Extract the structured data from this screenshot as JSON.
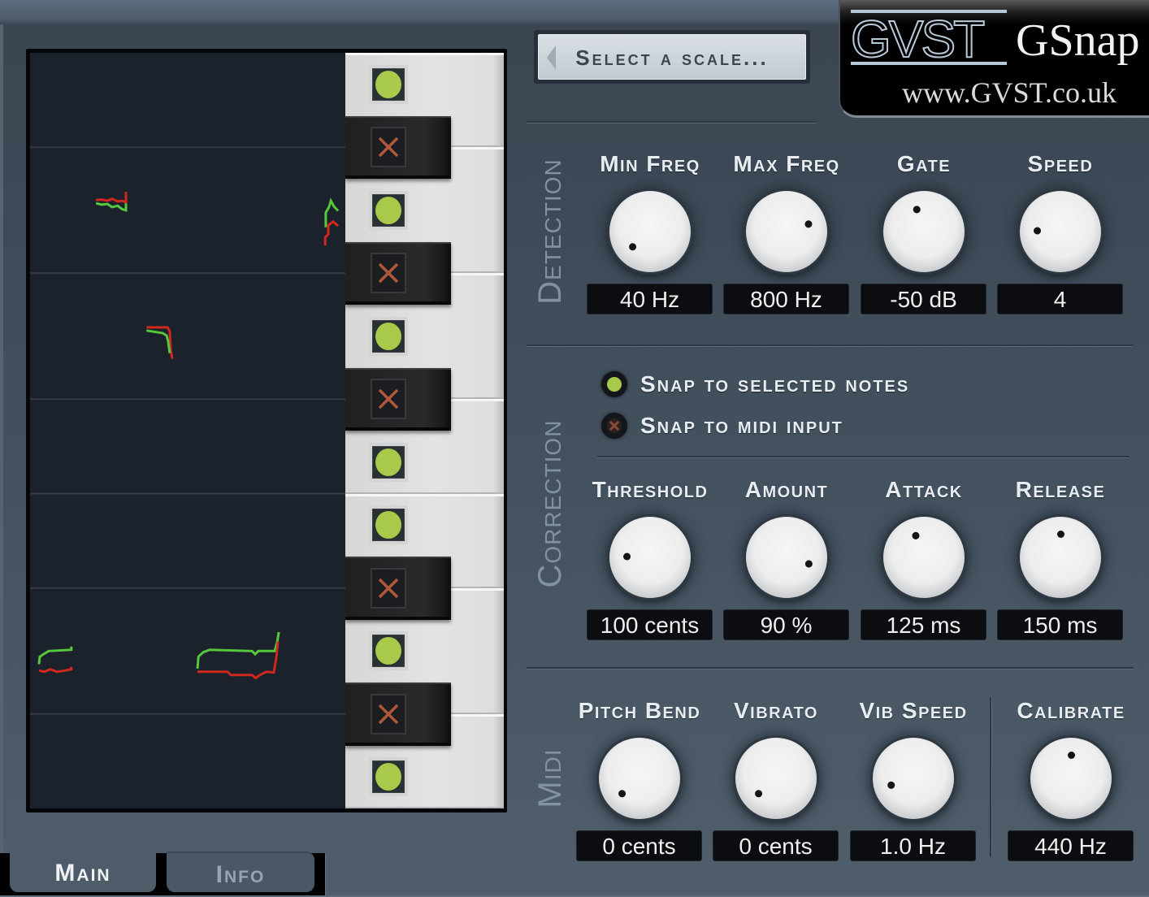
{
  "app": {
    "name": "GSnap",
    "vendor_logo": "GVST",
    "website": "www.GVST.co.uk"
  },
  "scale_button": {
    "label": "Select a scale...",
    "icon": "triangle-left-icon"
  },
  "pitch_display": {
    "time_range": [
      0,
      1
    ],
    "pitch_range_semitones_above_C": [
      -0.5,
      11.5
    ],
    "colors": {
      "detected": "#55c83c",
      "corrected": "#d0281e"
    },
    "traces": [
      {
        "kind": "detected",
        "points": [
          [
            0.209,
            9.11
          ],
          [
            0.227,
            9.09
          ],
          [
            0.245,
            9.1
          ],
          [
            0.26,
            9.05
          ],
          [
            0.278,
            9.07
          ],
          [
            0.291,
            9.02
          ],
          [
            0.304,
            9.0
          ],
          [
            0.304,
            9.16
          ]
        ]
      },
      {
        "kind": "corrected",
        "points": [
          [
            0.209,
            9.16
          ],
          [
            0.227,
            9.17
          ],
          [
            0.245,
            9.15
          ],
          [
            0.26,
            9.18
          ],
          [
            0.278,
            9.14
          ],
          [
            0.291,
            9.15
          ],
          [
            0.304,
            9.13
          ],
          [
            0.304,
            9.29
          ]
        ]
      },
      {
        "kind": "detected",
        "points": [
          [
            0.938,
            8.73
          ],
          [
            0.938,
            8.96
          ],
          [
            0.948,
            9.05
          ],
          [
            0.954,
            9.15
          ],
          [
            0.964,
            9.06
          ],
          [
            0.977,
            8.99
          ]
        ]
      },
      {
        "kind": "corrected",
        "points": [
          [
            0.936,
            8.44
          ],
          [
            0.936,
            8.57
          ],
          [
            0.946,
            8.62
          ],
          [
            0.946,
            8.76
          ],
          [
            0.961,
            8.82
          ],
          [
            0.977,
            8.75
          ]
        ]
      },
      {
        "kind": "corrected",
        "points": [
          [
            0.369,
            7.14
          ],
          [
            0.436,
            7.14
          ],
          [
            0.443,
            7.08
          ],
          [
            0.446,
            6.79
          ],
          [
            0.451,
            6.64
          ]
        ]
      },
      {
        "kind": "detected",
        "points": [
          [
            0.369,
            7.09
          ],
          [
            0.42,
            7.05
          ],
          [
            0.433,
            7.01
          ],
          [
            0.438,
            6.92
          ],
          [
            0.443,
            6.73
          ]
        ]
      },
      {
        "kind": "detected",
        "points": [
          [
            0.028,
            1.79
          ],
          [
            0.031,
            1.91
          ],
          [
            0.046,
            1.96
          ],
          [
            0.059,
            2.0
          ],
          [
            0.131,
            2.02
          ],
          [
            0.131,
            2.07
          ]
        ]
      },
      {
        "kind": "corrected",
        "points": [
          [
            0.028,
            1.69
          ],
          [
            0.046,
            1.67
          ],
          [
            0.064,
            1.71
          ],
          [
            0.085,
            1.67
          ],
          [
            0.111,
            1.69
          ],
          [
            0.131,
            1.71
          ],
          [
            0.131,
            1.75
          ]
        ]
      },
      {
        "kind": "detected",
        "points": [
          [
            0.531,
            1.72
          ],
          [
            0.534,
            1.91
          ],
          [
            0.549,
            1.98
          ],
          [
            0.57,
            2.02
          ],
          [
            0.704,
            2.0
          ],
          [
            0.714,
            1.95
          ],
          [
            0.724,
            2.0
          ],
          [
            0.776,
            2.0
          ],
          [
            0.784,
            2.15
          ],
          [
            0.789,
            2.3
          ]
        ]
      },
      {
        "kind": "corrected",
        "points": [
          [
            0.531,
            1.67
          ],
          [
            0.626,
            1.67
          ],
          [
            0.637,
            1.62
          ],
          [
            0.704,
            1.62
          ],
          [
            0.716,
            1.57
          ],
          [
            0.729,
            1.62
          ],
          [
            0.75,
            1.67
          ],
          [
            0.773,
            1.66
          ],
          [
            0.781,
            1.89
          ],
          [
            0.786,
            2.15
          ]
        ]
      }
    ]
  },
  "keyboard": {
    "selected_icon": "green-dot-icon",
    "unselected_icon": "x-mark-icon",
    "colors": {
      "selected": "#a9c94b",
      "unselected": "#b0583a"
    },
    "keys": [
      {
        "note": "B",
        "type": "white",
        "selected": true
      },
      {
        "note": "A#",
        "type": "black",
        "selected": false
      },
      {
        "note": "A",
        "type": "white",
        "selected": true
      },
      {
        "note": "G#",
        "type": "black",
        "selected": false
      },
      {
        "note": "G",
        "type": "white",
        "selected": true
      },
      {
        "note": "F#",
        "type": "black",
        "selected": false
      },
      {
        "note": "F",
        "type": "white",
        "selected": true
      },
      {
        "note": "E",
        "type": "white",
        "selected": true
      },
      {
        "note": "D#",
        "type": "black",
        "selected": false
      },
      {
        "note": "D",
        "type": "white",
        "selected": true
      },
      {
        "note": "C#",
        "type": "black",
        "selected": false
      },
      {
        "note": "C",
        "type": "white",
        "selected": true
      }
    ]
  },
  "sections": {
    "detection": {
      "title": "Detection",
      "knobs": [
        {
          "label": "Min Freq",
          "value": "40 Hz",
          "position": 0.01
        },
        {
          "label": "Max Freq",
          "value": "800 Hz",
          "position": 0.76
        },
        {
          "label": "Gate",
          "value": "-50 dB",
          "position": 0.43
        },
        {
          "label": "Speed",
          "value": "4",
          "position": 0.17
        }
      ]
    },
    "correction": {
      "title": "Correction",
      "options": [
        {
          "label": "Snap to selected notes",
          "selected": true
        },
        {
          "label": "Snap to midi input",
          "selected": false
        }
      ],
      "knobs": [
        {
          "label": "Threshold",
          "value": "100 cents",
          "position": 0.17
        },
        {
          "label": "Amount",
          "value": "90 %",
          "position": 0.89
        },
        {
          "label": "Attack",
          "value": "125 ms",
          "position": 0.42
        },
        {
          "label": "Release",
          "value": "150 ms",
          "position": 0.5
        }
      ]
    },
    "midi": {
      "title": "Midi",
      "knobs": [
        {
          "label": "Pitch Bend",
          "value": "0 cents",
          "position": 0.01
        },
        {
          "label": "Vibrato",
          "value": "0 cents",
          "position": 0.01
        },
        {
          "label": "Vib Speed",
          "value": "1.0 Hz",
          "position": 0.1
        }
      ]
    },
    "calibrate": {
      "label": "Calibrate",
      "value": "440 Hz",
      "position": 0.5
    }
  },
  "tabs": [
    {
      "label": "Main",
      "active": true
    },
    {
      "label": "Info",
      "active": false
    }
  ]
}
